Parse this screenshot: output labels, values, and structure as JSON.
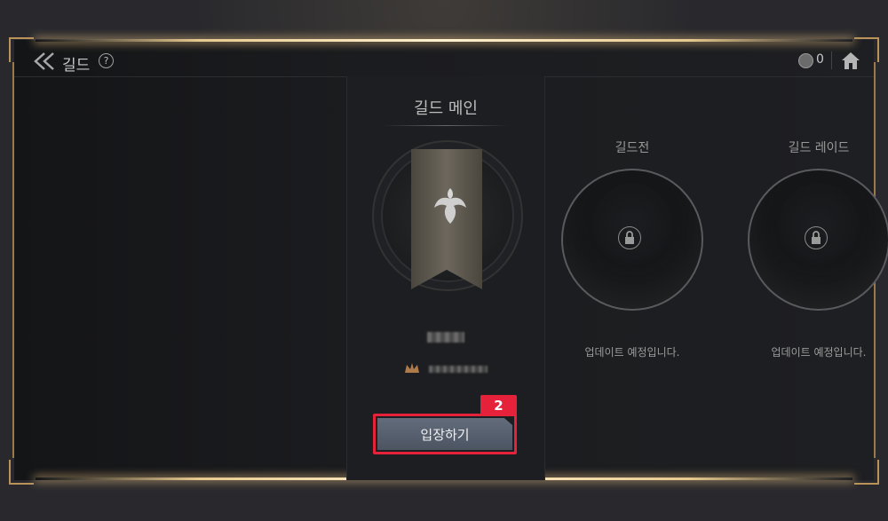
{
  "header": {
    "title": "길드",
    "help_label": "?",
    "currency_count": "0"
  },
  "main": {
    "title": "길드 메인",
    "enter_button_label": "입장하기",
    "step_number": "2"
  },
  "features": [
    {
      "title": "길드전",
      "desc": "업데이트 예정입니다."
    },
    {
      "title": "길드 레이드",
      "desc": "업데이트 예정입니다."
    }
  ],
  "colors": {
    "highlight": "#e6213a",
    "frame_gold": "#e7c98f",
    "button": "#5a6373"
  }
}
